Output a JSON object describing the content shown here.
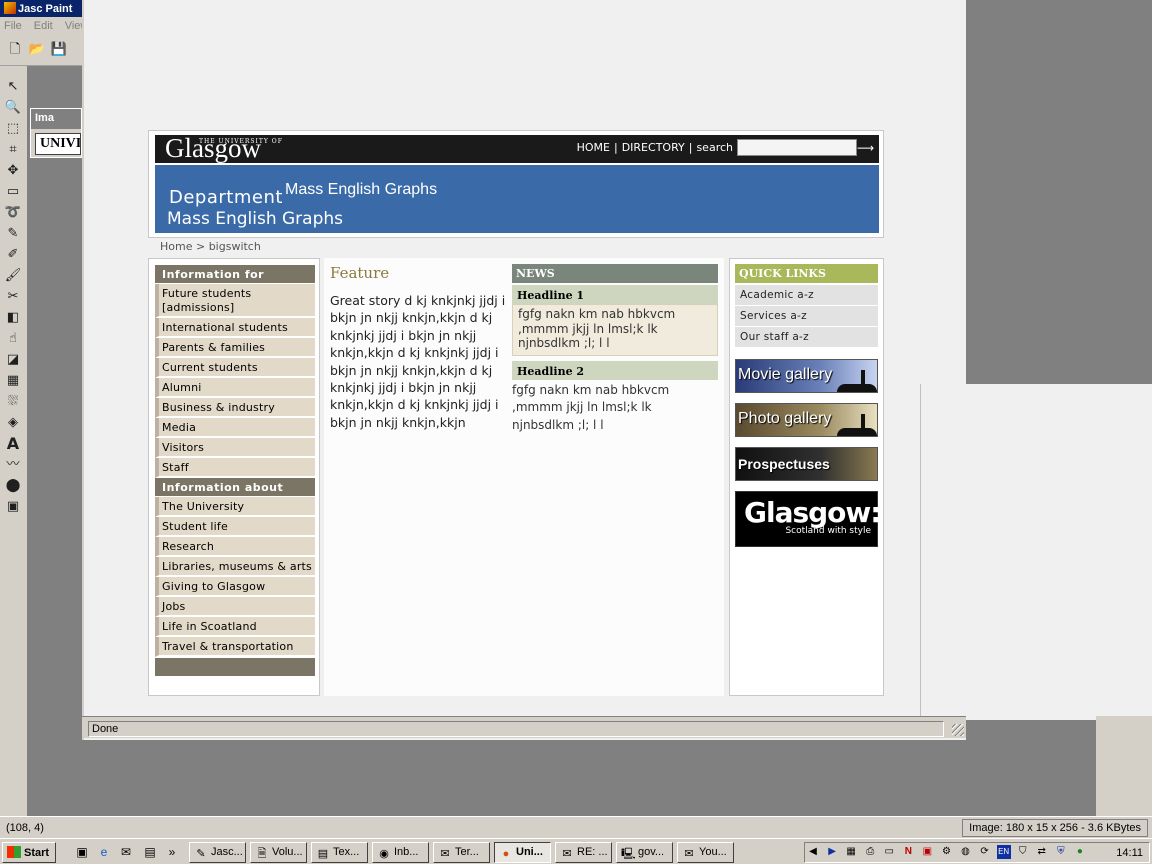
{
  "psp": {
    "title": "Jasc Paint",
    "menu": [
      "File",
      "Edit",
      "View"
    ],
    "image_window_title": "Ima",
    "image_window_text": "UNIVI",
    "status_coords": "(108, 4)",
    "status_image_info": "Image:  180 x 15 x 256 - 3.6 KBytes"
  },
  "browser": {
    "status": "Done"
  },
  "site": {
    "logo_small": "THE UNIVERSITY OF",
    "logo_main": "Glasgow",
    "nav_home": "HOME",
    "nav_sep": "|",
    "nav_directory": "DIRECTORY",
    "nav_search": "search",
    "search_go": "⟶",
    "banner_dept": "Department",
    "banner_title_top": "Mass English Graphs",
    "banner_title": "Mass English Graphs",
    "breadcrumb": "Home > bigswitch"
  },
  "left_nav": {
    "heading1": "Information for",
    "items1": [
      "Future students [admissions]",
      "International students",
      "Parents & families",
      "Current students",
      "Alumni",
      "Business & industry",
      "Media",
      "Visitors",
      "Staff"
    ],
    "heading2": "Information about",
    "items2": [
      "The University",
      "Student life",
      "Research",
      "Libraries, museums & arts",
      "Giving to Glasgow",
      "Jobs",
      "Life in Scoatland",
      "Travel & transportation"
    ]
  },
  "feature": {
    "heading": "Feature",
    "text": "Great story d kj knkjnkj jjdj i bkjn jn nkjj knkjn,kkjn d kj knkjnkj jjdj i bkjn jn nkjj knkjn,kkjn d kj knkjnkj jjdj i bkjn jn nkjj knkjn,kkjn d kj knkjnkj jjdj i bkjn jn nkjj knkjn,kkjn d kj knkjnkj jjdj i bkjn jn nkjj knkjn,kkjn"
  },
  "news": {
    "heading": "NEWS",
    "items": [
      {
        "headline": "Headline 1",
        "body": "fgfg nakn km nab hbkvcm ,mmmm jkjj ln lmsl;k lk njnbsdlkm ;l; l l"
      },
      {
        "headline": "Headline 2",
        "body": "fgfg nakn km nab hbkvcm ,mmmm jkjj ln lmsl;k lk njnbsdlkm ;l; l l"
      }
    ]
  },
  "quick_links": {
    "heading": "QUICK LINKS",
    "items": [
      "Academic a-z",
      "Services a-z",
      "Our staff a-z"
    ],
    "promos": [
      "Movie gallery",
      "Photo gallery",
      "Prospectuses"
    ],
    "glasgow_word": "Glasgow:",
    "glasgow_sub": "Scotland with style"
  },
  "taskbar": {
    "start": "Start",
    "tasks": [
      "Jasc...",
      "Volu...",
      "Tex...",
      "Inb...",
      "Ter...",
      "Uni...",
      "RE: ...",
      "gov...",
      "You..."
    ],
    "clock": "14:11"
  }
}
